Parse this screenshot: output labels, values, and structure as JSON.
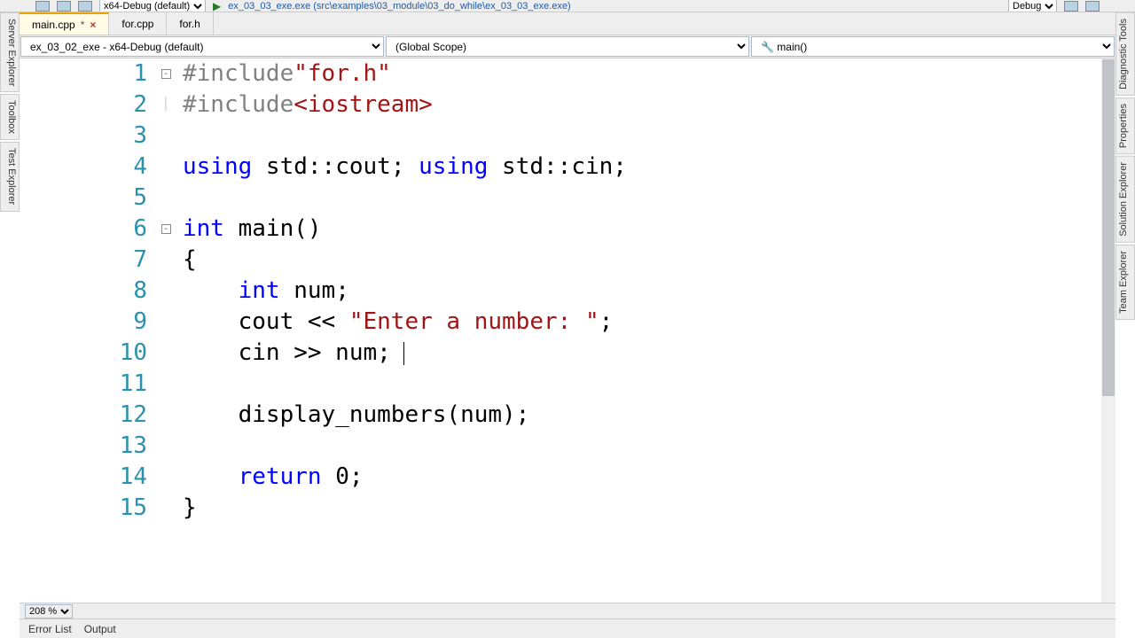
{
  "toolbar": {
    "config": "x64-Debug (default)",
    "path": "ex_03_03_exe.exe (src\\examples\\03_module\\03_do_while\\ex_03_03_exe.exe)",
    "mode": "Debug"
  },
  "tabs": [
    {
      "label": "main.cpp",
      "active": true,
      "dirty": true
    },
    {
      "label": "for.cpp",
      "active": false
    },
    {
      "label": "for.h",
      "active": false
    }
  ],
  "scopes": {
    "project": "ex_03_02_exe - x64-Debug (default)",
    "scope": "(Global Scope)",
    "member": "main()"
  },
  "code": {
    "lines": [
      {
        "n": "1",
        "fold": "-",
        "tokens": [
          {
            "t": "#include",
            "c": "pp"
          },
          {
            "t": "\"for.h\"",
            "c": "str"
          }
        ]
      },
      {
        "n": "2",
        "fold": "|",
        "tokens": [
          {
            "t": "#include",
            "c": "pp"
          },
          {
            "t": "<iostream>",
            "c": "str"
          }
        ]
      },
      {
        "n": "3",
        "tokens": []
      },
      {
        "n": "4",
        "tokens": [
          {
            "t": "using",
            "c": "kw"
          },
          {
            "t": " std::cout; "
          },
          {
            "t": "using",
            "c": "kw"
          },
          {
            "t": " std::cin;"
          }
        ]
      },
      {
        "n": "5",
        "tokens": []
      },
      {
        "n": "6",
        "fold": "-",
        "tokens": [
          {
            "t": "int",
            "c": "kw"
          },
          {
            "t": " main()"
          }
        ]
      },
      {
        "n": "7",
        "indent": 0,
        "tokens": [
          {
            "t": "{"
          }
        ]
      },
      {
        "n": "8",
        "indent": 1,
        "tokens": [
          {
            "t": "    "
          },
          {
            "t": "int",
            "c": "kw"
          },
          {
            "t": " num;"
          }
        ]
      },
      {
        "n": "9",
        "indent": 1,
        "tokens": [
          {
            "t": "    cout << "
          },
          {
            "t": "\"Enter a number: \"",
            "c": "str"
          },
          {
            "t": ";"
          }
        ]
      },
      {
        "n": "10",
        "indent": 1,
        "hl": true,
        "cursor": true,
        "tokens": [
          {
            "t": "    cin >> num;"
          }
        ]
      },
      {
        "n": "11",
        "indent": 1,
        "tokens": []
      },
      {
        "n": "12",
        "indent": 1,
        "tokens": [
          {
            "t": "    display_numbers(num);"
          }
        ]
      },
      {
        "n": "13",
        "indent": 1,
        "tokens": []
      },
      {
        "n": "14",
        "indent": 1,
        "tokens": [
          {
            "t": "    "
          },
          {
            "t": "return",
            "c": "kw"
          },
          {
            "t": " 0;"
          }
        ]
      },
      {
        "n": "15",
        "indent": 0,
        "tokens": [
          {
            "t": "}"
          }
        ]
      }
    ]
  },
  "zoom": "208 %",
  "side_left": [
    "Server Explorer",
    "Toolbox",
    "Test Explorer"
  ],
  "side_right": [
    "Diagnostic Tools",
    "Properties",
    "Solution Explorer",
    "Team Explorer"
  ],
  "bottom": [
    "Error List",
    "Output"
  ]
}
